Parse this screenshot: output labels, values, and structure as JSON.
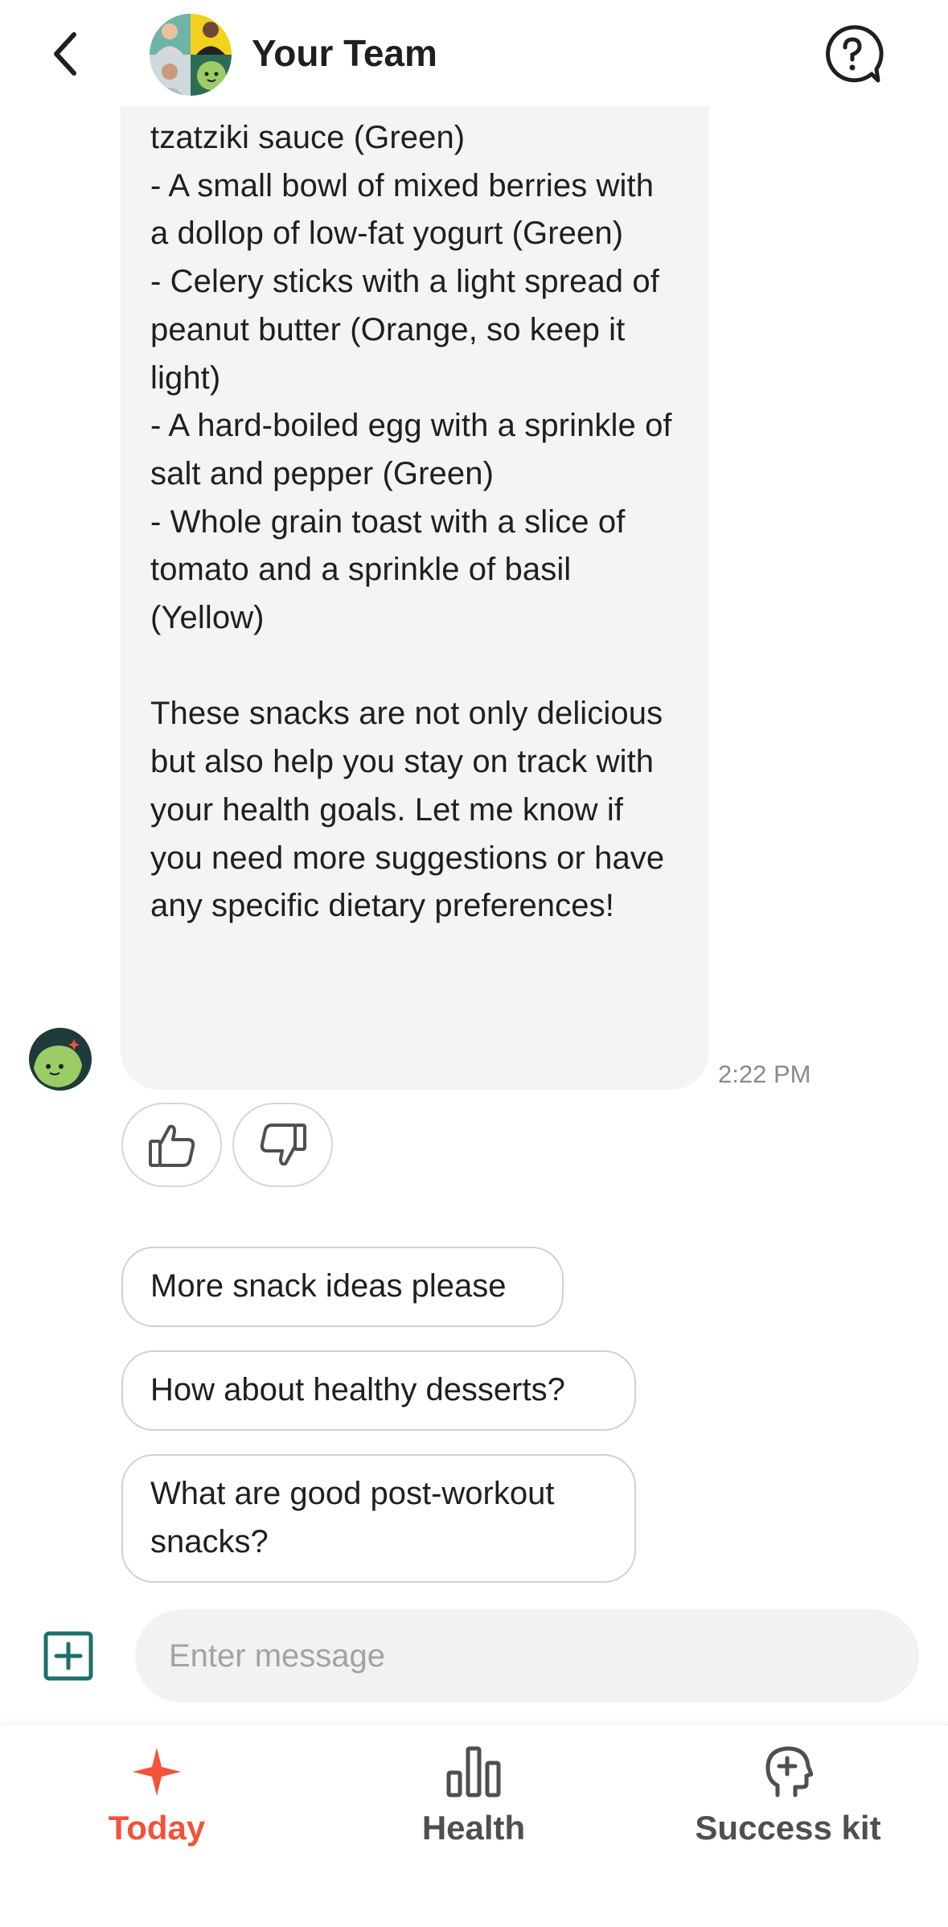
{
  "header": {
    "title": "Your Team",
    "back_icon": "chevron-left-icon",
    "help_icon": "question-bubble-icon"
  },
  "message": {
    "text": "tzatziki sauce (Green)\n- A small bowl of mixed berries with a dollop of low-fat yogurt (Green)\n- Celery sticks with a light spread of peanut butter (Orange, so keep it light)\n- A hard-boiled egg with a sprinkle of salt and pepper (Green)\n- Whole grain toast with a slice of tomato and a sprinkle of basil (Yellow)\n\nThese snacks are not only delicious but also help you stay on track with your health goals. Let me know if you need more suggestions or have any specific dietary preferences!",
    "time": "2:22 PM"
  },
  "feedback": {
    "up_icon": "thumbs-up-icon",
    "down_icon": "thumbs-down-icon"
  },
  "suggestions": [
    "More snack ideas please",
    "How about healthy desserts?",
    "What are good post-workout snacks?"
  ],
  "composer": {
    "placeholder": "Enter message",
    "add_icon": "plus-square-icon"
  },
  "nav": {
    "items": [
      {
        "label": "Today",
        "icon": "sparkle-icon",
        "active": true
      },
      {
        "label": "Health",
        "icon": "bar-chart-icon",
        "active": false
      },
      {
        "label": "Success kit",
        "icon": "head-plus-icon",
        "active": false
      }
    ]
  },
  "colors": {
    "accent": "#f2533a",
    "teal": "#1f6f6a",
    "bubble": "#f4f4f4",
    "bot_green": "#8bc34a"
  }
}
